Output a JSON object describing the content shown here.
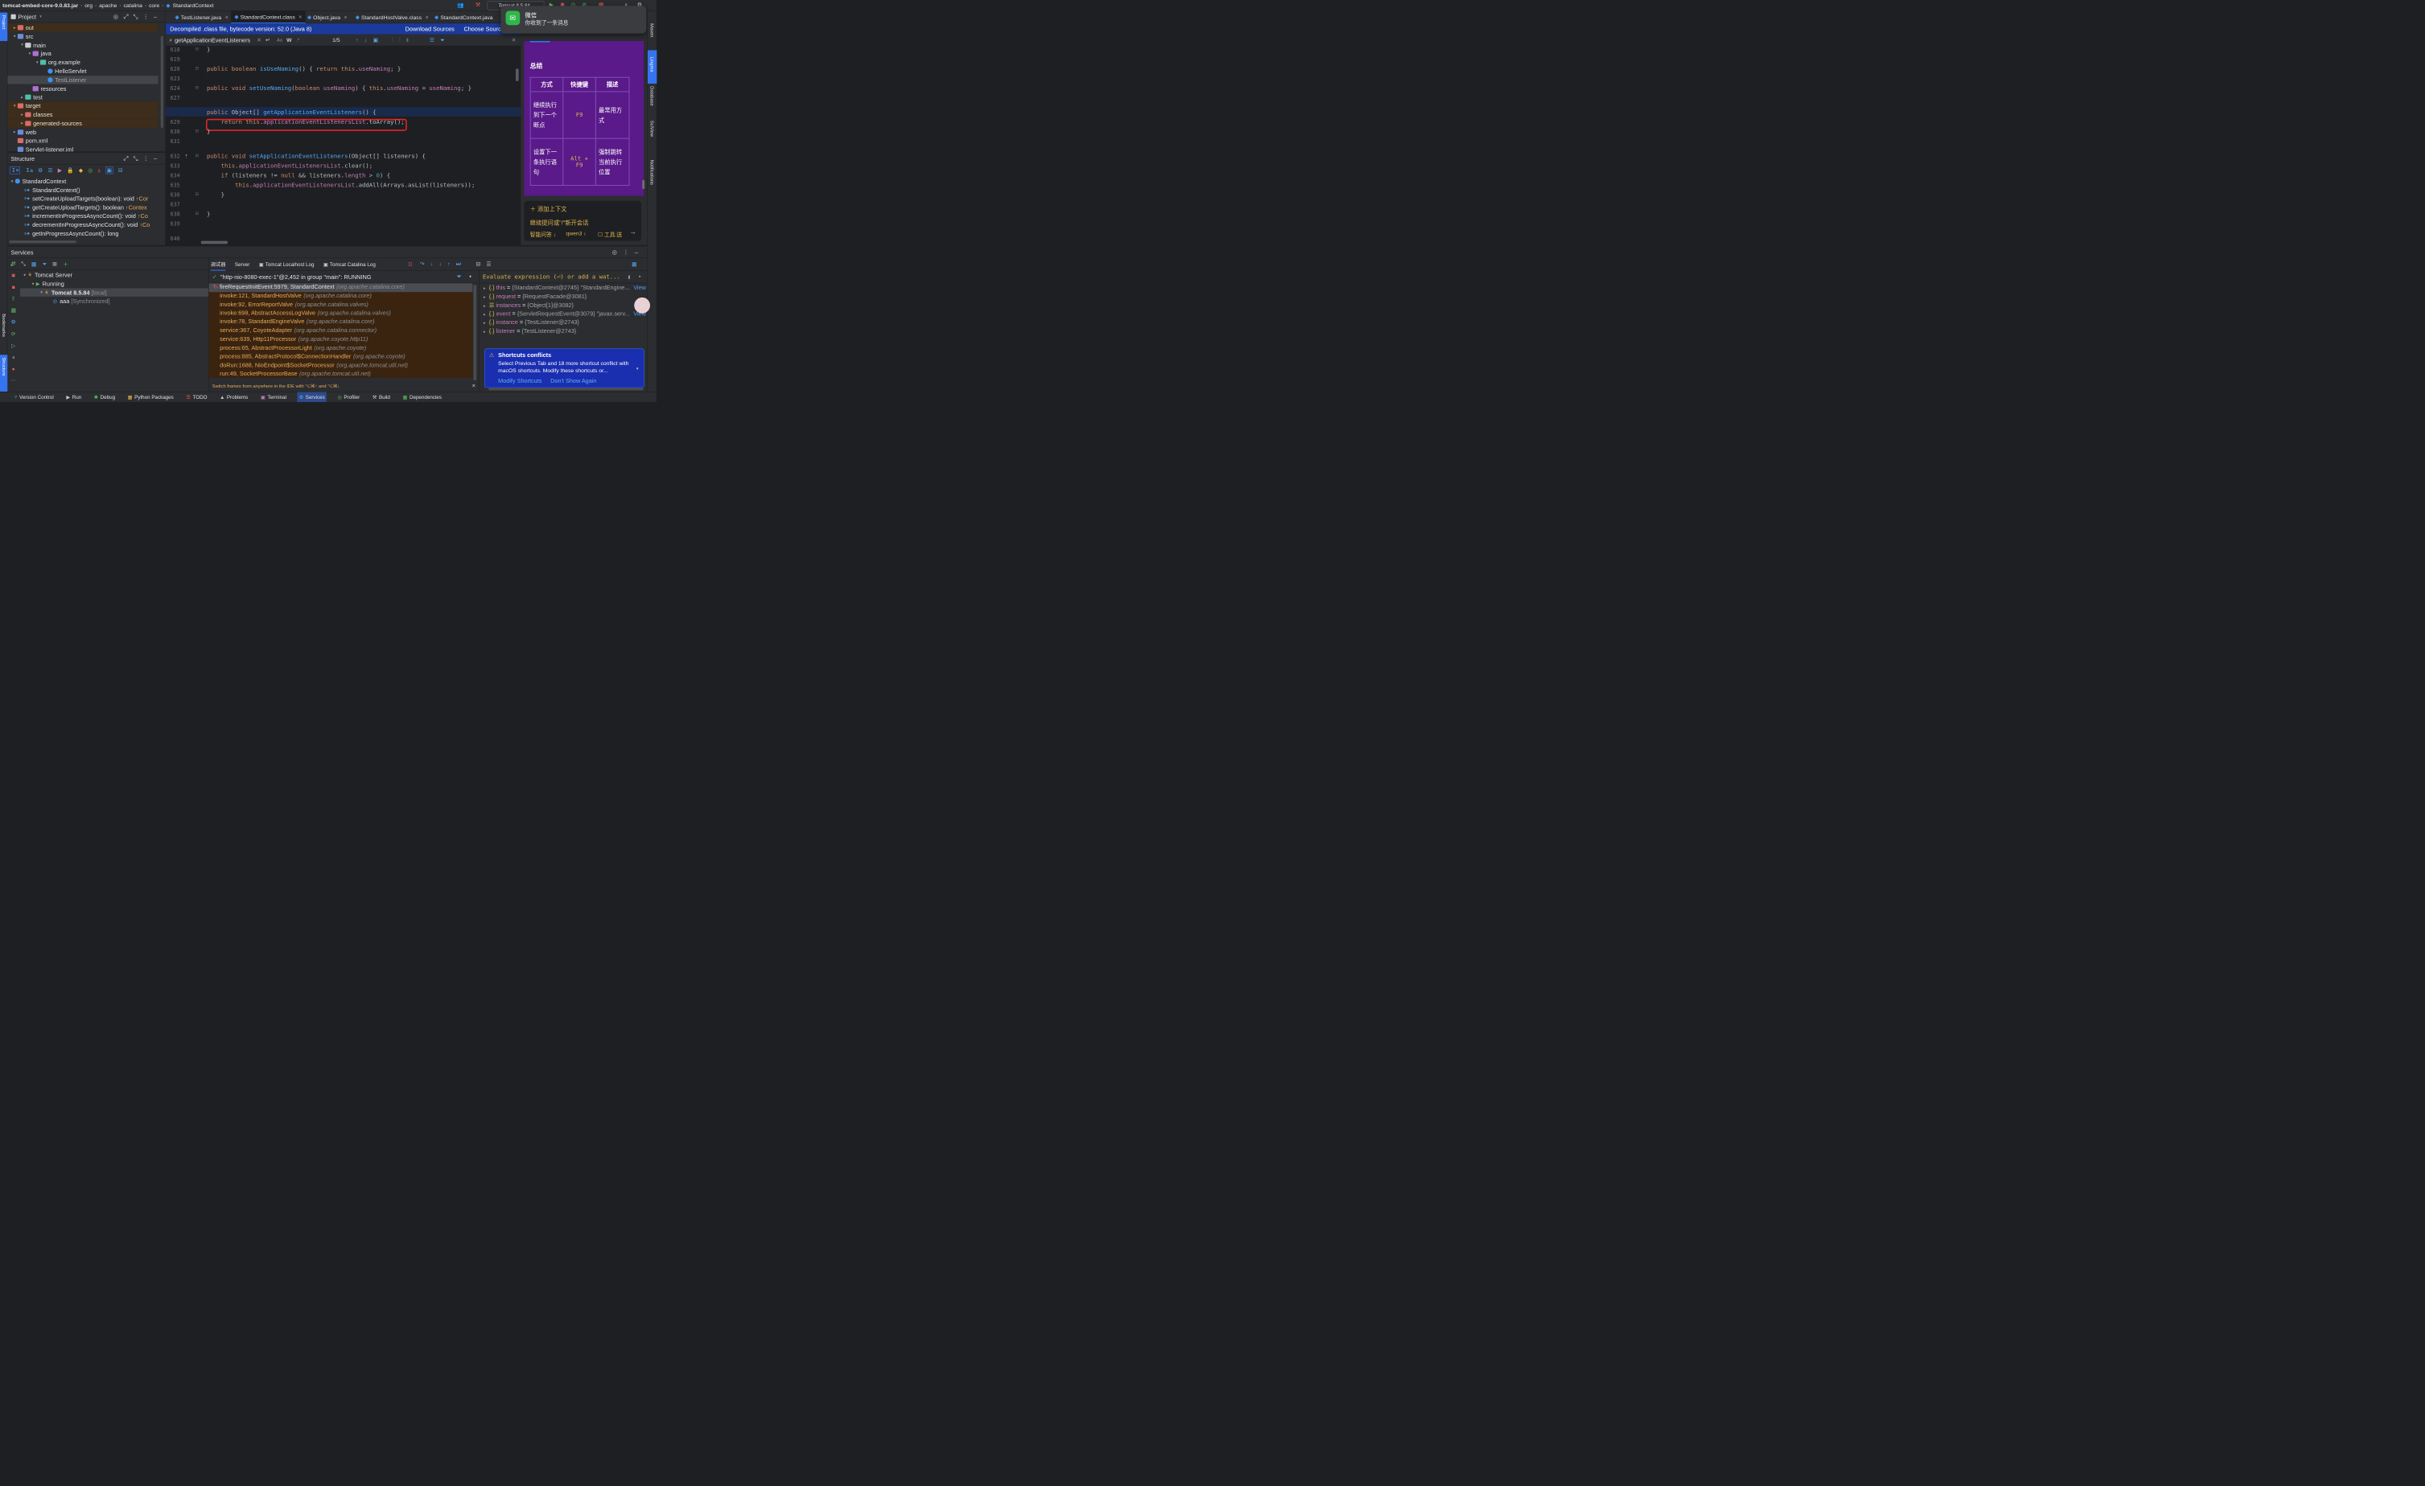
{
  "titlebar": {
    "crumbs": [
      "tomcat-embed-core-9.0.83.jar",
      "org",
      "apache",
      "catalina",
      "core",
      "StandardContext"
    ],
    "run_config": "Tomcat 8.5.84"
  },
  "notification": {
    "app": "微信",
    "message": "你收到了一条消息"
  },
  "project_panel": {
    "title": "Project",
    "tree": [
      {
        "label": "out",
        "depth": 1,
        "arrow": "▸",
        "icon": "folder-orange",
        "highlight": true
      },
      {
        "label": "src",
        "depth": 1,
        "arrow": "▾",
        "icon": "folder-blue"
      },
      {
        "label": "main",
        "depth": 2,
        "arrow": "▾",
        "icon": "folder-white"
      },
      {
        "label": "java",
        "depth": 3,
        "arrow": "▾",
        "icon": "folder-purple"
      },
      {
        "label": "org.example",
        "depth": 4,
        "arrow": "▾",
        "icon": "folder-teal"
      },
      {
        "label": "HelloServlet",
        "depth": 5,
        "arrow": "",
        "icon": "class-file"
      },
      {
        "label": "TestListener",
        "depth": 5,
        "arrow": "",
        "icon": "class-file",
        "selected": true
      },
      {
        "label": "resources",
        "depth": 3,
        "arrow": "",
        "icon": "folder-purple"
      },
      {
        "label": "test",
        "depth": 2,
        "arrow": "▸",
        "icon": "folder-teal"
      },
      {
        "label": "target",
        "depth": 1,
        "arrow": "▾",
        "icon": "folder-orange",
        "highlight": true
      },
      {
        "label": "classes",
        "depth": 2,
        "arrow": "▸",
        "icon": "folder-orange",
        "highlight": true
      },
      {
        "label": "generated-sources",
        "depth": 2,
        "arrow": "▸",
        "icon": "folder-orange",
        "highlight": true
      },
      {
        "label": "web",
        "depth": 1,
        "arrow": "▸",
        "icon": "folder-blue"
      },
      {
        "label": "pom.xml",
        "depth": 1,
        "arrow": "",
        "icon": "maven-file"
      },
      {
        "label": "Servlet-listener.iml",
        "depth": 1,
        "arrow": "",
        "icon": "iml-file"
      }
    ]
  },
  "structure_panel": {
    "title": "Structure",
    "root": "StandardContext",
    "members": [
      {
        "sig": "StandardContext()",
        "hint": ""
      },
      {
        "sig": "setCreateUploadTargets(boolean): void",
        "hint": "↑Cor"
      },
      {
        "sig": "getCreateUploadTargets(): boolean",
        "hint": "↑Contex"
      },
      {
        "sig": "incrementInProgressAsyncCount(): void",
        "hint": "↑Co"
      },
      {
        "sig": "decrementInProgressAsyncCount(): void",
        "hint": "↑Co"
      },
      {
        "sig": "getInProgressAsyncCount(): long",
        "hint": ""
      }
    ]
  },
  "editor": {
    "tabs": [
      {
        "label": "TestListener.java",
        "active": false,
        "close": true
      },
      {
        "label": "StandardContext.class",
        "active": true,
        "close": true
      },
      {
        "label": "Object.java",
        "active": false,
        "close": true
      },
      {
        "label": "StandardHostValve.class",
        "active": false,
        "close": true
      },
      {
        "label": "StandardContext.java",
        "active": false,
        "close": false
      }
    ],
    "banner": {
      "text": "Decompiled .class file, bytecode version: 52.0 (Java 8)",
      "download": "Download Sources",
      "choose": "Choose Sources..."
    },
    "find": {
      "query": "getApplicationEventListeners",
      "count": "1/5",
      "case_label": "Aa",
      "word_label": "W",
      "regex_label": ".*"
    },
    "lines": [
      {
        "n": "618",
        "code": "}"
      },
      {
        "n": "619",
        "code": ""
      },
      {
        "n": "620",
        "code": "public boolean isUseNaming() { return this.useNaming; }"
      },
      {
        "n": "623",
        "code": ""
      },
      {
        "n": "624",
        "code": "public void setUseNaming(boolean useNaming) { this.useNaming = useNaming; }"
      },
      {
        "n": "627",
        "code": ""
      },
      {
        "n": "628",
        "code": "public Object[] getApplicationEventListeners() {"
      },
      {
        "n": "629",
        "code": "    return this.applicationEventListenersList.toArray();"
      },
      {
        "n": "630",
        "code": "}"
      },
      {
        "n": "631",
        "code": ""
      },
      {
        "n": "632",
        "code": "public void setApplicationEventListeners(Object[] listeners) {"
      },
      {
        "n": "633",
        "code": "    this.applicationEventListenersList.clear();"
      },
      {
        "n": "634",
        "code": "    if (listeners != null && listeners.length > 0) {"
      },
      {
        "n": "635",
        "code": "        this.applicationEventListenersList.addAll(Arrays.asList(listeners));"
      },
      {
        "n": "636",
        "code": "    }"
      },
      {
        "n": "637",
        "code": ""
      },
      {
        "n": "638",
        "code": "}"
      },
      {
        "n": "639",
        "code": ""
      },
      {
        "n": "640",
        "code": ""
      }
    ]
  },
  "ai_panel": {
    "heading": "总结",
    "table_headers": [
      "方式",
      "快捷键",
      "描述"
    ],
    "rows": [
      {
        "way": "继续执行到下一个断点",
        "key": "F9",
        "desc": "最常用方式"
      },
      {
        "way": "设置下一条执行语句",
        "key": "Alt + F9",
        "desc": "强制跳转当前执行位置"
      }
    ],
    "add_context": "添加上下文",
    "input_placeholder": "继续提问或\"/\"新开会话",
    "mode": "智能问答",
    "model": "qwen3",
    "tool_label": "工具:送"
  },
  "services": {
    "title": "Services",
    "tree": [
      {
        "label": "Tomcat Server",
        "depth": 0,
        "arrow": "▾"
      },
      {
        "label": "Running",
        "depth": 1,
        "arrow": "▾"
      },
      {
        "label": "Tomcat 8.5.84",
        "depth": 2,
        "arrow": "▾",
        "suffix": "[local]",
        "selected": true
      },
      {
        "label": "aaa",
        "depth": 3,
        "arrow": "",
        "suffix": "[Synchronized]"
      }
    ],
    "tabs": [
      "调试器",
      "Server",
      "Tomcat Localhost Log",
      "Tomcat Catalina Log"
    ],
    "thread": "\"http-nio-8080-exec-1\"@2,452 in group \"main\": RUNNING",
    "frames": [
      {
        "m": "fireRequestInitEvent:5979, StandardContext",
        "p": "(org.apache.catalina.core)",
        "current": true
      },
      {
        "m": "invoke:121, StandardHostValve",
        "p": "(org.apache.catalina.core)"
      },
      {
        "m": "invoke:92, ErrorReportValve",
        "p": "(org.apache.catalina.valves)"
      },
      {
        "m": "invoke:698, AbstractAccessLogValve",
        "p": "(org.apache.catalina.valves)"
      },
      {
        "m": "invoke:78, StandardEngineValve",
        "p": "(org.apache.catalina.core)"
      },
      {
        "m": "service:367, CoyoteAdapter",
        "p": "(org.apache.catalina.connector)"
      },
      {
        "m": "service:639, Http11Processor",
        "p": "(org.apache.coyote.http11)"
      },
      {
        "m": "process:65, AbstractProcessorLight",
        "p": "(org.apache.coyote)"
      },
      {
        "m": "process:885, AbstractProtocol$ConnectionHandler",
        "p": "(org.apache.coyote)"
      },
      {
        "m": "doRun:1688, NioEndpoint$SocketProcessor",
        "p": "(org.apache.tomcat.util.net)"
      },
      {
        "m": "run:49, SocketProcessorBase",
        "p": "(org.apache.tomcat.util.net)"
      }
    ],
    "frames_hint": "Switch frames from anywhere in the IDE with ⌥⌘↑ and ⌥⌘↓",
    "eval_placeholder": "Evaluate expression (⏎) or add a wat...",
    "variables": [
      {
        "name": "this",
        "value": "{StandardContext@2745} \"StandardEngine...",
        "link": "View"
      },
      {
        "name": "request",
        "value": "{RequestFacade@3081}",
        "link": ""
      },
      {
        "name": "instances",
        "value": "{Object[1]@3082}",
        "link": ""
      },
      {
        "name": "event",
        "value": "{ServletRequestEvent@3079} \"javax.serv...",
        "link": "View"
      },
      {
        "name": "instance",
        "value": "{TestListener@2743}",
        "link": ""
      },
      {
        "name": "listener",
        "value": "{TestListener@2743}",
        "link": ""
      }
    ],
    "conflict": {
      "title": "Shortcuts conflicts",
      "body": "Select Previous Tab and 18 more shortcut conflict with macOS shortcuts. Modify these shortcuts or...",
      "modify": "Modify Shortcuts",
      "dismiss": "Don't Show Again"
    }
  },
  "left_strip": {
    "project": "Project",
    "bookmarks": "Bookmarks",
    "structure": "Structure"
  },
  "right_strip": {
    "maven": "Maven",
    "lingma": "Lingma",
    "database": "Database",
    "sciview": "SciView",
    "notifications": "Notifications"
  },
  "bottom_bar": [
    "Version Control",
    "Run",
    "Debug",
    "Python Packages",
    "TODO",
    "Problems",
    "Terminal",
    "Services",
    "Profiler",
    "Build",
    "Dependencies"
  ],
  "colors": {
    "accent": "#3574f0",
    "banner": "#1a3a9c",
    "ai_bg": "#5a1a8a",
    "frame_text": "#e7a85d",
    "highlight_box": "#e0262b"
  }
}
